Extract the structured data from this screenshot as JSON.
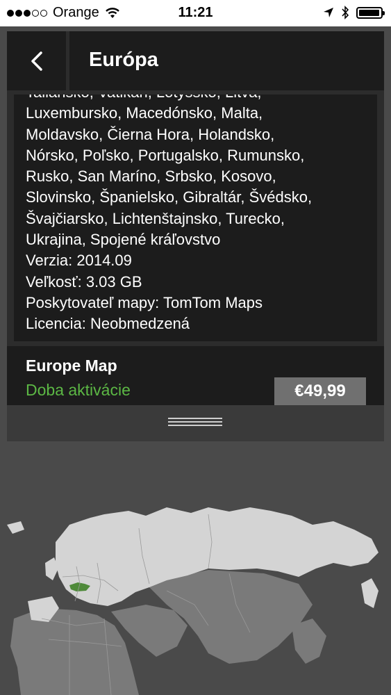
{
  "status_bar": {
    "carrier": "Orange",
    "time": "11:21",
    "signal_full": 3,
    "signal_empty": 2,
    "battery_level": 0.95
  },
  "header": {
    "back_icon": "chevron-left-icon",
    "title": "Európa"
  },
  "description": {
    "lines": [
      "Taliansko, Vatikán, Lotyšsko, Litva,",
      "Luxembursko, Macedónsko, Malta,",
      "Moldavsko, Čierna Hora, Holandsko,",
      "Nórsko, Poľsko, Portugalsko, Rumunsko,",
      "Rusko, San Maríno, Srbsko, Kosovo,",
      "Slovinsko, Španielsko, Gibraltár, Švédsko,",
      "Švajčiarsko, Lichtenštajnsko, Turecko,",
      "Ukrajina, Spojené kráľovstvo",
      "Verzia: 2014.09",
      "Veľkosť: 3.03 GB",
      "Poskytovateľ mapy: TomTom Maps",
      "Licencia: Neobmedzená"
    ]
  },
  "product": {
    "name": "Europe Map",
    "subtitle": "Doba aktivácie",
    "price": "€49,99"
  },
  "colors": {
    "accent_green": "#5cb845",
    "panel_bg": "#1c1c1c",
    "page_bg": "#4a4a4a",
    "price_bg": "#707070",
    "map_land": "#d4d4d4",
    "map_land_dark": "#7a7a7a",
    "map_highlight": "#4f8a3a"
  },
  "icons": [
    "wifi-icon",
    "location-arrow-icon",
    "bluetooth-icon",
    "battery-icon",
    "drag-handle-icon",
    "world-map"
  ]
}
